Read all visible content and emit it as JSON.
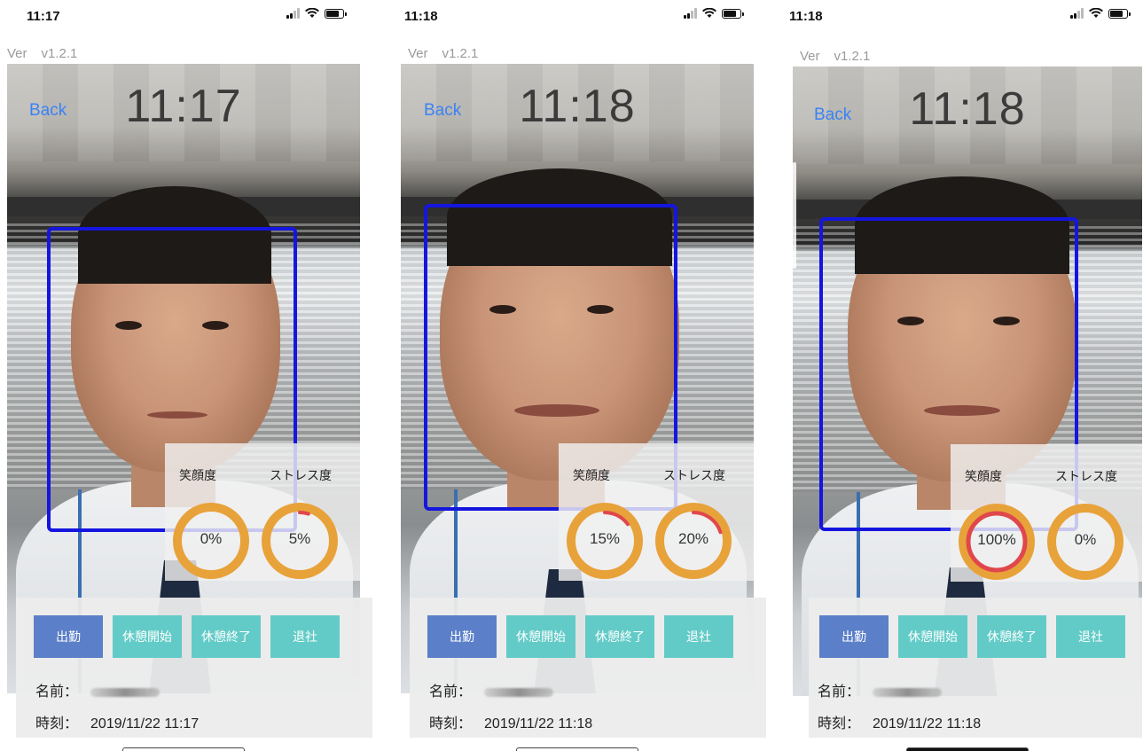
{
  "screens": [
    {
      "status_time": "11:17",
      "version_label": "Ver",
      "version_value": "v1.2.1",
      "back_label": "Back",
      "camera_clock": "11:17",
      "smile_label": "笑顔度",
      "stress_label": "ストレス度",
      "smile_value": "0%",
      "stress_value": "5%",
      "smile_level": 0.0,
      "stress_level": 0.05,
      "buttons": [
        "出勤",
        "休憩開始",
        "休憩終了",
        "退社"
      ],
      "name_label": "名前：",
      "time_label": "時刻：",
      "time_value": "2019/11/22 11:17"
    },
    {
      "status_time": "11:18",
      "version_label": "Ver",
      "version_value": "v1.2.1",
      "back_label": "Back",
      "camera_clock": "11:18",
      "smile_label": "笑顔度",
      "stress_label": "ストレス度",
      "smile_value": "15%",
      "stress_value": "20%",
      "smile_level": 0.15,
      "stress_level": 0.2,
      "buttons": [
        "出勤",
        "休憩開始",
        "休憩終了",
        "退社"
      ],
      "name_label": "名前：",
      "time_label": "時刻：",
      "time_value": "2019/11/22 11:18"
    },
    {
      "status_time": "11:18",
      "version_label": "Ver",
      "version_value": "v1.2.1",
      "back_label": "Back",
      "camera_clock": "11:18",
      "smile_label": "笑顔度",
      "stress_label": "ストレス度",
      "smile_value": "100%",
      "stress_value": "0%",
      "smile_level": 1.0,
      "stress_level": 0.0,
      "buttons": [
        "出勤",
        "休憩開始",
        "休憩終了",
        "退社"
      ],
      "name_label": "名前：",
      "time_label": "時刻：",
      "time_value": "2019/11/22 11:18"
    }
  ],
  "colors": {
    "primary_button": "#5b7fc8",
    "secondary_button": "#62cbc7",
    "face_box": "#1515e0",
    "gauge_track": "#e8a23a",
    "gauge_value": "#e0474c",
    "back_link": "#3b82f6"
  },
  "icons": [
    "signal-icon",
    "wifi-icon",
    "battery-icon"
  ]
}
